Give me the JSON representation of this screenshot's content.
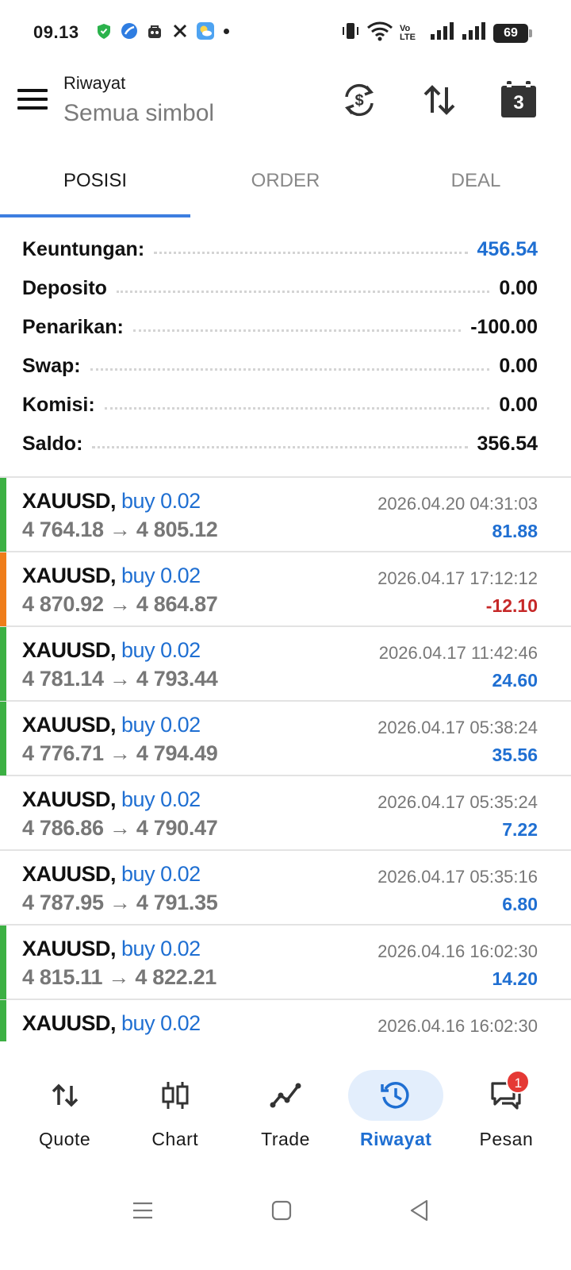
{
  "status_bar": {
    "time": "09.13",
    "battery": "69",
    "volte": "Vo LTE"
  },
  "app_bar": {
    "title": "Riwayat",
    "subtitle": "Semua simbol",
    "calendar_day": "3"
  },
  "tabs": [
    {
      "label": "POSISI",
      "active": true
    },
    {
      "label": "ORDER",
      "active": false
    },
    {
      "label": "DEAL",
      "active": false
    }
  ],
  "summary": [
    {
      "label": "Keuntungan:",
      "value": "456.54",
      "highlight": true
    },
    {
      "label": "Deposito",
      "value": "0.00",
      "highlight": false
    },
    {
      "label": "Penarikan:",
      "value": "-100.00",
      "highlight": false
    },
    {
      "label": "Swap:",
      "value": "0.00",
      "highlight": false
    },
    {
      "label": "Komisi:",
      "value": "0.00",
      "highlight": false
    },
    {
      "label": "Saldo:",
      "value": "356.54",
      "highlight": false
    }
  ],
  "deals": [
    {
      "symbol": "XAUUSD,",
      "type": "buy 0.02",
      "open": "4 764.18",
      "close": "4 805.12",
      "time": "2026.04.20 04:31:03",
      "profit": "81.88",
      "bar": "green"
    },
    {
      "symbol": "XAUUSD,",
      "type": "buy 0.02",
      "open": "4 870.92",
      "close": "4 864.87",
      "time": "2026.04.17 17:12:12",
      "profit": "-12.10",
      "bar": "orange"
    },
    {
      "symbol": "XAUUSD,",
      "type": "buy 0.02",
      "open": "4 781.14",
      "close": "4 793.44",
      "time": "2026.04.17 11:42:46",
      "profit": "24.60",
      "bar": "green"
    },
    {
      "symbol": "XAUUSD,",
      "type": "buy 0.02",
      "open": "4 776.71",
      "close": "4 794.49",
      "time": "2026.04.17 05:38:24",
      "profit": "35.56",
      "bar": "green"
    },
    {
      "symbol": "XAUUSD,",
      "type": "buy 0.02",
      "open": "4 786.86",
      "close": "4 790.47",
      "time": "2026.04.17 05:35:24",
      "profit": "7.22",
      "bar": "none"
    },
    {
      "symbol": "XAUUSD,",
      "type": "buy 0.02",
      "open": "4 787.95",
      "close": "4 791.35",
      "time": "2026.04.17 05:35:16",
      "profit": "6.80",
      "bar": "none"
    },
    {
      "symbol": "XAUUSD,",
      "type": "buy 0.02",
      "open": "4 815.11",
      "close": "4 822.21",
      "time": "2026.04.16 16:02:30",
      "profit": "14.20",
      "bar": "green"
    },
    {
      "symbol": "XAUUSD,",
      "type": "buy 0.02",
      "open": "",
      "close": "",
      "time": "2026.04.16 16:02:30",
      "profit": "",
      "bar": "green"
    }
  ],
  "bottom_nav": [
    {
      "label": "Quote",
      "icon": "quote-arrows-icon",
      "active": false
    },
    {
      "label": "Chart",
      "icon": "candlestick-icon",
      "active": false
    },
    {
      "label": "Trade",
      "icon": "trade-line-icon",
      "active": false
    },
    {
      "label": "Riwayat",
      "icon": "history-clock-icon",
      "active": true
    },
    {
      "label": "Pesan",
      "icon": "message-icon",
      "active": false,
      "badge": "1"
    }
  ],
  "colors": {
    "accent": "#1f6fd2",
    "profit_positive": "#1f6fd2",
    "profit_negative": "#c62828",
    "bar_green": "#3cb043",
    "bar_orange": "#ef7d1a",
    "tab_indicator": "#3d7ee0"
  }
}
